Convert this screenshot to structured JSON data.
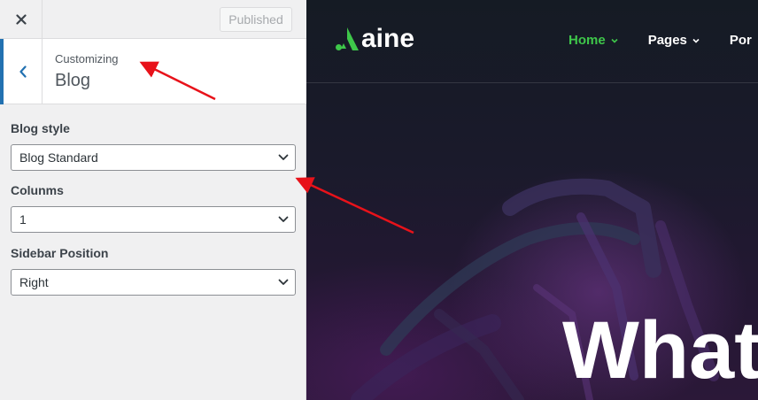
{
  "customizer": {
    "publish_button": "Published",
    "breadcrumb": "Customizing",
    "section_title": "Blog",
    "controls": [
      {
        "label": "Blog style",
        "value": "Blog Standard"
      },
      {
        "label": "Colunms",
        "value": "1"
      },
      {
        "label": "Sidebar Position",
        "value": "Right"
      }
    ]
  },
  "preview": {
    "logo_text": "aine",
    "nav": [
      {
        "label": "Home",
        "active": true
      },
      {
        "label": "Pages",
        "active": false
      },
      {
        "label": "Por",
        "active": false
      }
    ],
    "hero_heading": "What"
  },
  "colors": {
    "accent_blue": "#2271b1",
    "brand_green": "#3ec74a",
    "annotation_red": "#e8121a"
  },
  "icons": [
    "close-icon",
    "chevron-left-icon",
    "chevron-down-icon",
    "logo-triangle-icon",
    "caret-down-icon"
  ]
}
